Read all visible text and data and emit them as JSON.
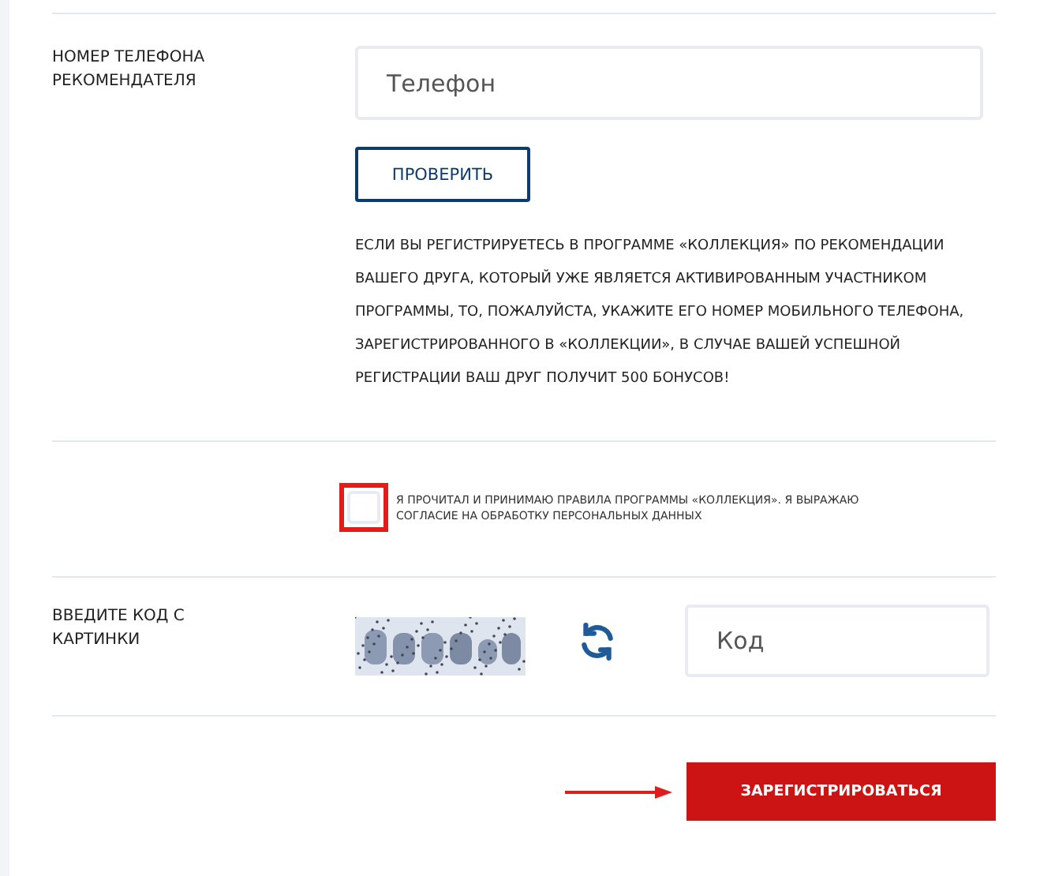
{
  "referrer": {
    "label": "НОМЕР ТЕЛЕФОНА РЕКОМЕНДАТЕЛЯ",
    "phone_field": {
      "placeholder": "Телефон"
    },
    "check_button": "ПРОВЕРИТЬ",
    "note": "ЕСЛИ ВЫ РЕГИСТРИРУЕТЕСЬ В ПРОГРАММЕ «КОЛЛЕКЦИЯ» ПО РЕКОМЕНДАЦИИ ВАШЕГО ДРУГА, КОТОРЫЙ УЖЕ ЯВЛЯЕТСЯ АКТИВИРОВАННЫМ УЧАСТНИКОМ ПРОГРАММЫ, ТО, ПОЖАЛУЙСТА, УКАЖИТЕ ЕГО НОМЕР МОБИЛЬНОГО ТЕЛЕФОНА, ЗАРЕГИСТРИРОВАННОГО В «КОЛЛЕКЦИИ», В СЛУЧАЕ ВАШЕЙ УСПЕШНОЙ РЕГИСТРАЦИИ ВАШ ДРУГ ПОЛУЧИТ 500 БОНУСОВ!"
  },
  "consent": {
    "checked": false,
    "highlighted": true,
    "text": "Я ПРОЧИТАЛ И ПРИНИМАЮ ПРАВИЛА ПРОГРАММЫ «КОЛЛЕКЦИЯ». Я ВЫРАЖАЮ СОГЛАСИЕ НА ОБРАБОТКУ ПЕРСОНАЛЬНЫХ ДАННЫХ"
  },
  "captcha": {
    "label": "ВВЕДИТЕ КОД С КАРТИНКИ",
    "code_field": {
      "placeholder": "Код"
    }
  },
  "submit": {
    "label": "ЗАРЕГИСТРИРОВАТЬСЯ",
    "pointer_arrow": true
  }
}
